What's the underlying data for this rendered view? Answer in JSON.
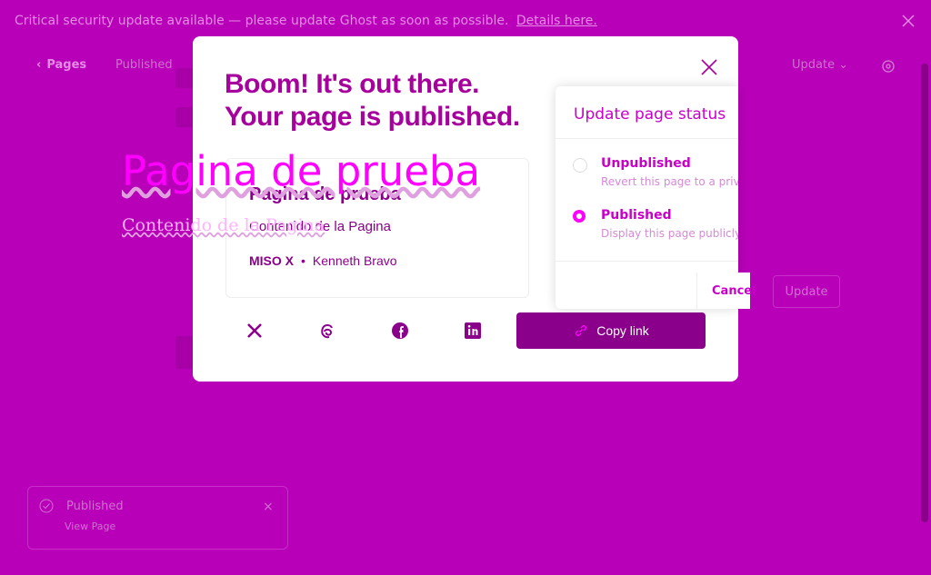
{
  "banner": {
    "message": "Critical security update available — please update Ghost as soon as possible.",
    "link": "Details here."
  },
  "header": {
    "back_label": "Pages",
    "status": "Published",
    "update_label": "Update"
  },
  "editor": {
    "title": "Pagina de prueba",
    "body": "Contenido de la Pagina"
  },
  "modal": {
    "headline1": "Boom! It's out there.",
    "headline2": "Your page is published.",
    "preview": {
      "title": "Pagina de prueba",
      "excerpt": "Contenido de la Pagina",
      "site": "MISO X",
      "author": "Kenneth Bravo"
    },
    "copy_label": "Copy link"
  },
  "status_popover": {
    "title": "Update page status",
    "options": [
      {
        "label": "Unpublished",
        "desc": "Revert this page to a private draft"
      },
      {
        "label": "Published",
        "desc": "Display this page publicly"
      }
    ],
    "cancel": "Cancel",
    "update": "Update"
  },
  "toast": {
    "title": "Published",
    "link": "View Page"
  },
  "colors": {
    "background": "#b800b8",
    "accent": "#ff00ff",
    "modal_text": "#a6009d",
    "button": "#8b008b"
  }
}
